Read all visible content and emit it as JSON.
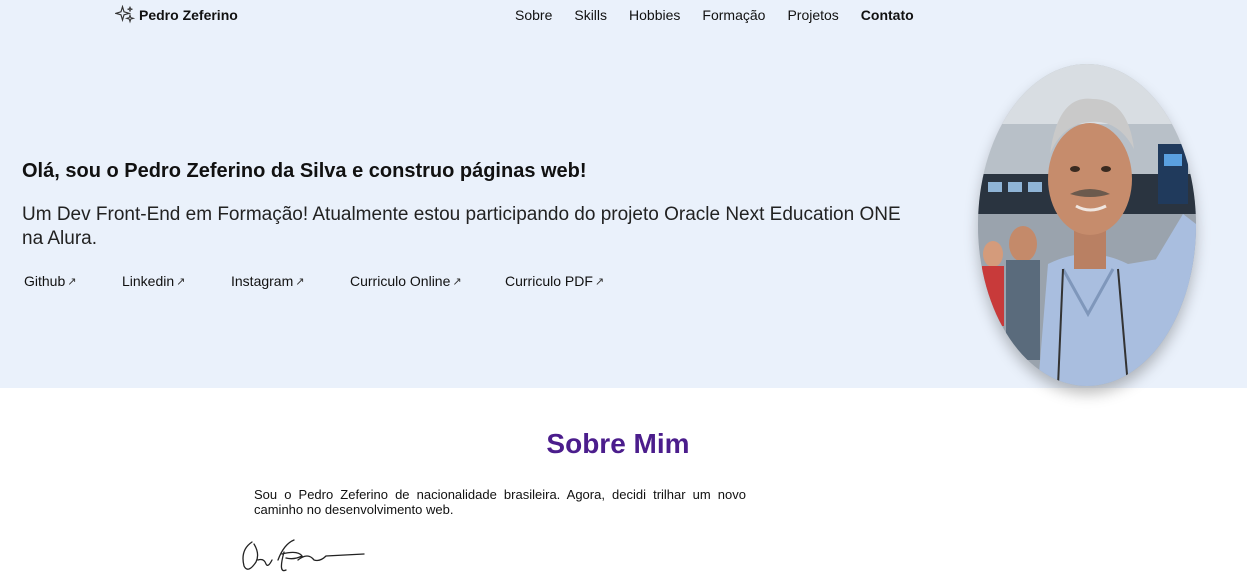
{
  "brand": {
    "name": "Pedro Zeferino",
    "icon": "sparkles-icon"
  },
  "nav": {
    "items": [
      {
        "label": "Sobre",
        "active": false
      },
      {
        "label": "Skills",
        "active": false
      },
      {
        "label": "Hobbies",
        "active": false
      },
      {
        "label": "Formação",
        "active": false
      },
      {
        "label": "Projetos",
        "active": false
      },
      {
        "label": "Contato",
        "active": true
      }
    ]
  },
  "hero": {
    "headline": "Olá, sou o Pedro Zeferino da Silva e construo páginas web!",
    "subline": "Um Dev Front-End em Formação! Atualmente estou participando do projeto Oracle Next Education ONE na Alura.",
    "links": [
      {
        "label": "Github",
        "arrow": "↗"
      },
      {
        "label": "Linkedin",
        "arrow": "↗"
      },
      {
        "label": "Instagram",
        "arrow": "↗"
      },
      {
        "label": "Curriculo Online",
        "arrow": "↗"
      },
      {
        "label": "Curriculo PDF",
        "arrow": "↗"
      }
    ],
    "background": "#eaf1fb"
  },
  "about": {
    "title": "Sobre Mim",
    "text": "Sou o Pedro Zeferino de nacionalidade brasileira. Agora, decidi trilhar um novo caminho no desenvolvimento web.",
    "title_color": "#4b1d8c"
  }
}
